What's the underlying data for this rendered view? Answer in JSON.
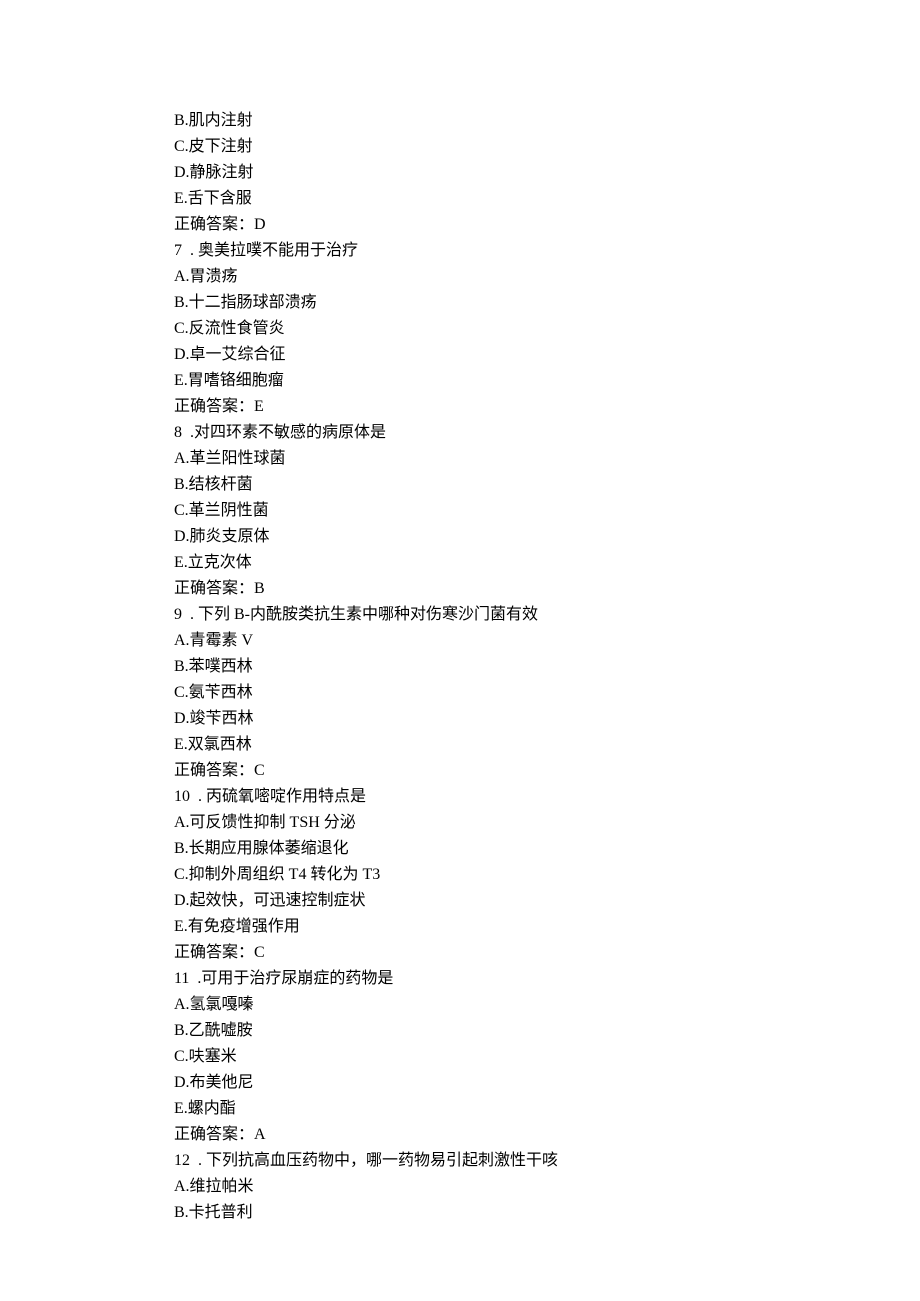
{
  "lines": [
    "B.肌内注射",
    "C.皮下注射",
    "D.静脉注射",
    "E.舌下含服",
    "正确答案：D",
    "7  . 奥美拉噗不能用于治疗",
    "A.胃溃疡",
    "B.十二指肠球部溃疡",
    "C.反流性食管炎",
    "D.卓一艾综合征",
    "E.胃嗜铬细胞瘤",
    "正确答案：E",
    "8  .对四环素不敏感的病原体是",
    "A.革兰阳性球菌",
    "B.结核杆菌",
    "C.革兰阴性菌",
    "D.肺炎支原体",
    "E.立克次体",
    "正确答案：B",
    "9  . 下列 B-内酰胺类抗生素中哪种对伤寒沙门菌有效",
    "A.青霉素 V",
    "B.苯噗西林",
    "C.氨苄西林",
    "D.竣苄西林",
    "E.双氯西林",
    "正确答案：C",
    "10  . 丙硫氧嘧啶作用特点是",
    "A.可反馈性抑制 TSH 分泌",
    "B.长期应用腺体萎缩退化",
    "C.抑制外周组织 T4 转化为 T3",
    "D.起效快，可迅速控制症状",
    "E.有免疫增强作用",
    "正确答案：C",
    "11  .可用于治疗尿崩症的药物是",
    "A.氢氯嘎嗪",
    "B.乙酰嘘胺",
    "C.呋塞米",
    "D.布美他尼",
    "E.螺内酯",
    "正确答案：A",
    "12  . 下列抗高血压药物中，哪一药物易引起刺激性干咳",
    "A.维拉帕米",
    "B.卡托普利"
  ]
}
